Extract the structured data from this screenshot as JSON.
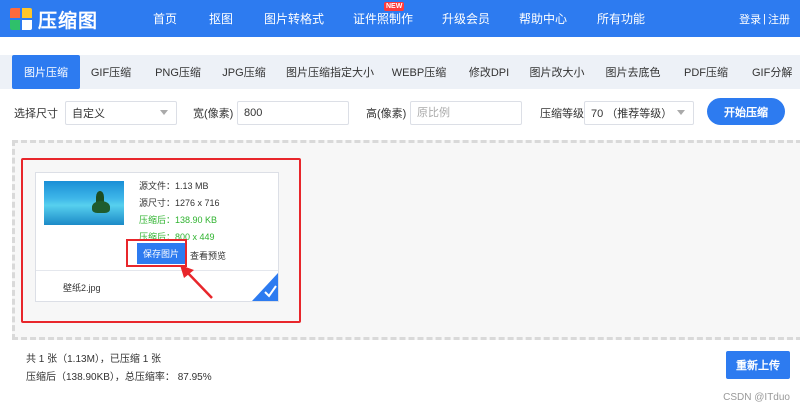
{
  "brand": {
    "name": "压缩图"
  },
  "nav": {
    "items": [
      "首页",
      "抠图",
      "图片转格式",
      "证件照制作",
      "升级会员",
      "帮助中心",
      "所有功能"
    ],
    "new_badge": "NEW",
    "login": "登录",
    "register": "注册"
  },
  "tabs": [
    "图片压缩",
    "GIF压缩",
    "PNG压缩",
    "JPG压缩",
    "图片压缩指定大小",
    "WEBP压缩",
    "修改DPI",
    "图片改大小",
    "图片去底色",
    "PDF压缩",
    "GIF分解"
  ],
  "options": {
    "size_label": "选择尺寸",
    "size_value": "自定义",
    "width_label": "宽(像素)",
    "width_value": "800",
    "height_label": "高(像素)",
    "height_placeholder": "原比例",
    "level_label": "压缩等级",
    "level_value": "70 （推荐等级）",
    "start_button": "开始压缩"
  },
  "file": {
    "source_file": "源文件：1.13 MB",
    "source_size": "源尺寸：1276 x 716",
    "compressed_file": "压缩后：138.90 KB",
    "compressed_size": "压缩后：800 x 449",
    "save_button": "保存图片",
    "preview_link": "查看预览",
    "name": "壁纸2.jpg"
  },
  "summary": {
    "line1": "共 1 张（1.13M），已压缩 1 张",
    "line2": "压缩后（138.90KB），总压缩率： 87.95%"
  },
  "reupload_button": "重新上传",
  "watermark": "CSDN @ITduo",
  "colors": {
    "primary": "#2d7bf0",
    "annotation_red": "#e8262b",
    "success_green": "#2fb32f"
  }
}
